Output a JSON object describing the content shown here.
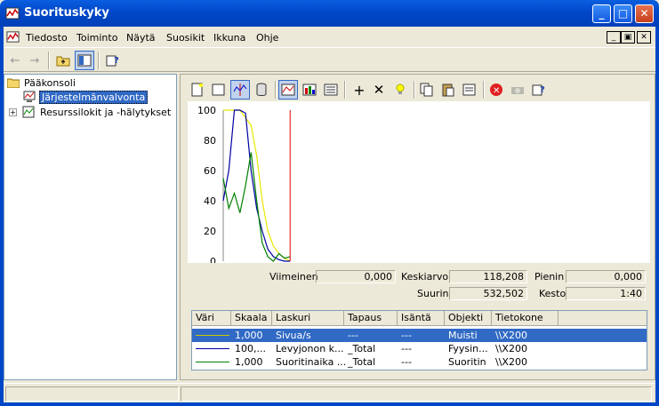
{
  "window": {
    "title": "Suorituskyky"
  },
  "menu": [
    "Tiedosto",
    "Toiminto",
    "Näytä",
    "Suosikit",
    "Ikkuna",
    "Ohje"
  ],
  "tree": {
    "root": "Pääkonsoli",
    "items": [
      {
        "label": "Järjestelmänvalvonta",
        "selected": true
      },
      {
        "label": "Resurssilokit ja -hälytykset",
        "selected": false
      }
    ]
  },
  "stats": {
    "last_label": "Viimeinen",
    "last_value": "0,000",
    "avg_label": "Keskiarvo",
    "avg_value": "118,208",
    "min_label": "Pienin",
    "min_value": "0,000",
    "max_label": "Suurin",
    "max_value": "532,502",
    "dur_label": "Kesto",
    "dur_value": "1:40"
  },
  "counters": {
    "columns": [
      "Väri",
      "Skaala",
      "Laskuri",
      "Tapaus",
      "Isäntä",
      "Objekti",
      "Tietokone"
    ],
    "rows": [
      {
        "color": "#c8c800",
        "scale": "1,000",
        "counter": "Sivua/s",
        "instance": "---",
        "host": "---",
        "object": "Muisti",
        "computer": "\\\\X200",
        "selected": true
      },
      {
        "color": "#0000a0",
        "scale": "100,...",
        "counter": "Levyjonon k...",
        "instance": "_Total",
        "host": "---",
        "object": "Fyysin...",
        "computer": "\\\\X200",
        "selected": false
      },
      {
        "color": "#008000",
        "scale": "1,000",
        "counter": "Suoritinaika ...",
        "instance": "_Total",
        "host": "---",
        "object": "Suoritin",
        "computer": "\\\\X200",
        "selected": false
      }
    ]
  },
  "chart_data": {
    "type": "line",
    "ylim": [
      0,
      100
    ],
    "yticks": [
      "100",
      "80",
      "60",
      "40",
      "20",
      "0"
    ],
    "xlabel": "",
    "ylabel": "",
    "title": "",
    "cursor_x": 48,
    "series": [
      {
        "color": "#e8e800",
        "x": [
          0,
          4,
          8,
          12,
          16,
          20,
          24,
          28,
          32,
          36,
          40,
          44,
          48
        ],
        "values": [
          100,
          100,
          100,
          100,
          95,
          90,
          70,
          40,
          20,
          10,
          5,
          2,
          0
        ]
      },
      {
        "color": "#0000a0",
        "x": [
          0,
          4,
          8,
          12,
          16,
          20,
          24,
          28,
          32,
          36,
          40,
          44,
          48
        ],
        "values": [
          40,
          60,
          100,
          100,
          98,
          60,
          35,
          20,
          8,
          3,
          1,
          0,
          0
        ]
      },
      {
        "color": "#008000",
        "x": [
          0,
          4,
          8,
          12,
          16,
          20,
          24,
          28,
          32,
          36,
          40,
          44,
          48
        ],
        "values": [
          55,
          35,
          45,
          32,
          50,
          72,
          40,
          12,
          3,
          0,
          5,
          2,
          3
        ]
      }
    ]
  }
}
